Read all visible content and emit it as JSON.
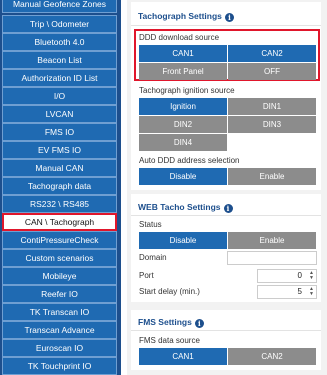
{
  "sidebar": {
    "items": [
      {
        "label": "Manual Geofence Zones"
      },
      {
        "label": "Trip \\ Odometer"
      },
      {
        "label": "Bluetooth 4.0"
      },
      {
        "label": "Beacon List"
      },
      {
        "label": "Authorization ID List"
      },
      {
        "label": "I/O"
      },
      {
        "label": "LVCAN"
      },
      {
        "label": "FMS IO"
      },
      {
        "label": "EV FMS IO"
      },
      {
        "label": "Manual CAN"
      },
      {
        "label": "Tachograph data"
      },
      {
        "label": "RS232 \\ RS485"
      },
      {
        "label": "CAN \\ Tachograph",
        "active": true
      },
      {
        "label": "ContiPressureCheck"
      },
      {
        "label": "Custom scenarios"
      },
      {
        "label": "Mobileye"
      },
      {
        "label": "Reefer IO"
      },
      {
        "label": "TK Transcan IO"
      },
      {
        "label": "Transcan Advance"
      },
      {
        "label": "Euroscan IO"
      },
      {
        "label": "TK Touchprint IO"
      }
    ]
  },
  "tachograph_settings": {
    "title": "Tachograph Settings",
    "ddd_source": {
      "label": "DDD download source",
      "options": [
        "CAN1",
        "CAN2",
        "Front Panel",
        "OFF"
      ],
      "selected": "CAN2"
    },
    "ignition_source": {
      "label": "Tachograph ignition source",
      "options": [
        "Ignition",
        "DIN1",
        "DIN2",
        "DIN3",
        "DIN4"
      ],
      "selected": "Ignition"
    },
    "auto_ddd": {
      "label": "Auto DDD address selection",
      "options": [
        "Disable",
        "Enable"
      ],
      "selected": "Disable"
    }
  },
  "web_tacho_settings": {
    "title": "WEB Tacho Settings",
    "status": {
      "label": "Status",
      "options": [
        "Disable",
        "Enable"
      ],
      "selected": "Disable"
    },
    "domain": {
      "label": "Domain",
      "value": ""
    },
    "port": {
      "label": "Port",
      "value": "0"
    },
    "start_delay": {
      "label": "Start delay (min.)",
      "value": "5"
    }
  },
  "fms_settings": {
    "title": "FMS Settings",
    "data_source": {
      "label": "FMS data source",
      "options": [
        "CAN1",
        "CAN2"
      ],
      "selected": "CAN1"
    }
  },
  "colors": {
    "accent": "#1f6ab2",
    "sidebar": "#1d4f8d",
    "inactive": "#8c8c8c",
    "highlight": "#e0162b"
  },
  "icons": {
    "info": "info-icon",
    "spinner": "spinner-arrows-icon"
  }
}
